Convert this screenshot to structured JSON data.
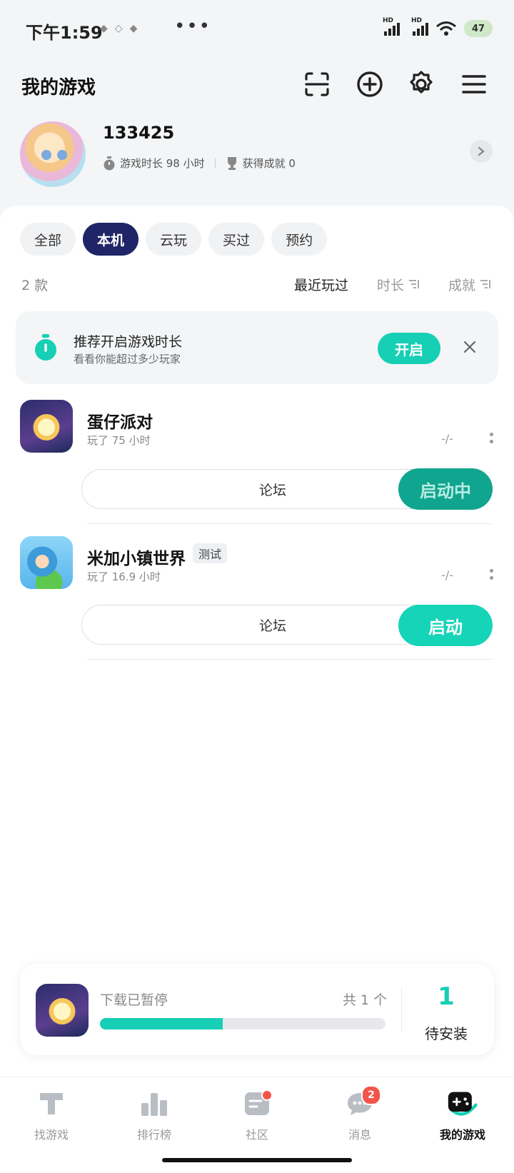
{
  "status_bar": {
    "time": "下午1:59",
    "dots": "•••",
    "battery": "47",
    "hd": "HD"
  },
  "header": {
    "title": "我的游戏"
  },
  "profile": {
    "username": "133425",
    "playtime_label": "游戏时长 98 小时",
    "achievements_label": "获得成就 0"
  },
  "filters": {
    "chips": [
      "全部",
      "本机",
      "云玩",
      "买过",
      "预约"
    ],
    "active": "本机"
  },
  "list_header": {
    "count": "2 款",
    "sort_recent": "最近玩过",
    "sort_duration": "时长",
    "sort_achievement": "成就"
  },
  "tip": {
    "title": "推荐开启游戏时长",
    "subtitle": "看看你能超过多少玩家",
    "button": "开启"
  },
  "games": [
    {
      "name": "蛋仔派对",
      "played": "玩了 75 小时",
      "progress": "-/-",
      "forum_label": "论坛",
      "launch_label": "启动中",
      "tag": ""
    },
    {
      "name": "米加小镇世界",
      "played": "玩了 16.9 小时",
      "progress": "-/-",
      "forum_label": "论坛",
      "launch_label": "启动",
      "tag": "测试"
    }
  ],
  "download": {
    "status": "下载已暂停",
    "total": "共 1 个",
    "progress_fraction": 0.43,
    "pending_count": "1",
    "pending_label": "待安装"
  },
  "nav": {
    "items": [
      "找游戏",
      "排行榜",
      "社区",
      "消息",
      "我的游戏"
    ],
    "message_badge": "2",
    "active": "我的游戏"
  },
  "colors": {
    "accent": "#16cfb4",
    "chip_active": "#1f2566",
    "badge_red": "#f3544a"
  }
}
